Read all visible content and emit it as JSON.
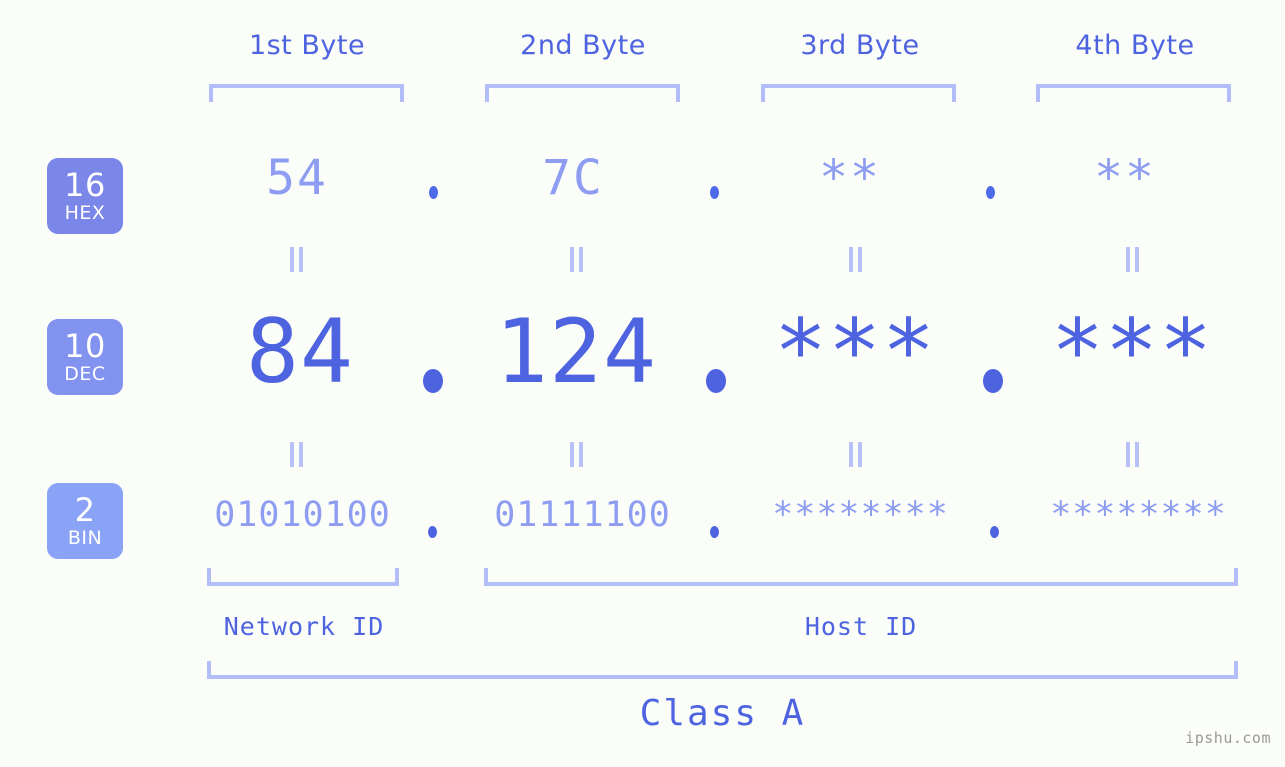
{
  "watermark": "ipshu.com",
  "byte_headers": [
    {
      "label": "1st Byte"
    },
    {
      "label": "2nd Byte"
    },
    {
      "label": "3rd Byte"
    },
    {
      "label": "4th Byte"
    }
  ],
  "radix_badges": [
    {
      "num": "16",
      "abbr": "HEX"
    },
    {
      "num": "10",
      "abbr": "DEC"
    },
    {
      "num": "2",
      "abbr": "BIN"
    }
  ],
  "rows": {
    "hex": {
      "radix": "16",
      "name": "HEX",
      "octets": [
        "54",
        "7C",
        "**",
        "**"
      ],
      "separator": "."
    },
    "dec": {
      "radix": "10",
      "name": "DEC",
      "octets": [
        "84",
        "124",
        "***",
        "***"
      ],
      "separator": "."
    },
    "bin": {
      "radix": "2",
      "name": "BIN",
      "octets": [
        "01010100",
        "01111100",
        "********",
        "********"
      ],
      "separator": "."
    }
  },
  "equality_marks": [
    "||",
    "||",
    "||",
    "||",
    "||",
    "||",
    "||",
    "||"
  ],
  "segments": {
    "network_id": "Network ID",
    "host_id": "Host ID",
    "class": "Class A"
  },
  "colors": {
    "background": "#fbfdf9",
    "accent_strong": "#4d63e0",
    "accent_light": "#8e9df2",
    "bracket": "#b3bdf7",
    "badge_hex": "#7b87e8",
    "badge_dec": "#8292ef",
    "badge_bin": "#8ba3f7",
    "watermark": "#9a9a9a"
  }
}
